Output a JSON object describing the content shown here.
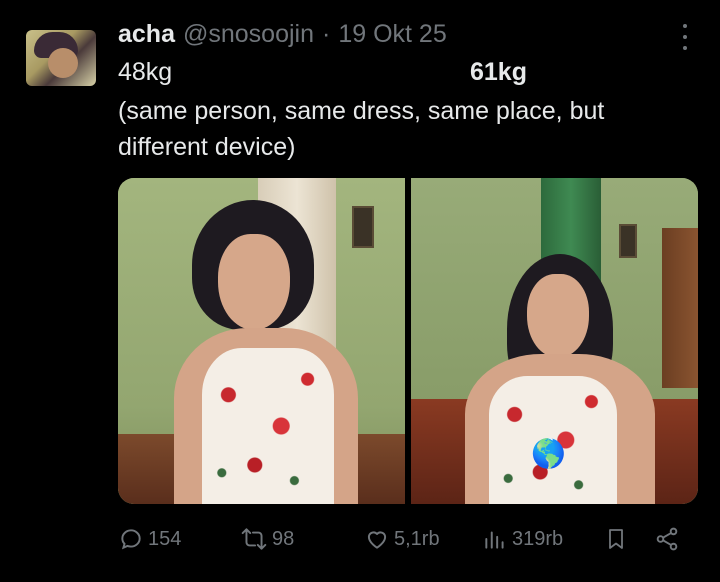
{
  "tweet": {
    "display_name": "acha",
    "handle": "@snosoojin",
    "separator": "·",
    "date": "19 Okt 25",
    "weight_left": "48kg",
    "weight_right": "61kg",
    "caption": "(same person, same dress, same place, but different device)"
  },
  "media": {
    "photos": [
      {
        "description": "photo-left"
      },
      {
        "description": "photo-right"
      }
    ],
    "emoji": "🌎"
  },
  "actions": {
    "reply_count": "154",
    "repost_count": "98",
    "like_count": "5,1rb",
    "view_count": "319rb"
  },
  "icons": {
    "more": "more-icon",
    "reply": "reply-icon",
    "repost": "repost-icon",
    "like": "heart-icon",
    "views": "views-icon",
    "bookmark": "bookmark-icon",
    "share": "share-icon"
  },
  "colors": {
    "background": "#000000",
    "text_primary": "#e7e9ea",
    "text_secondary": "#71767b"
  }
}
